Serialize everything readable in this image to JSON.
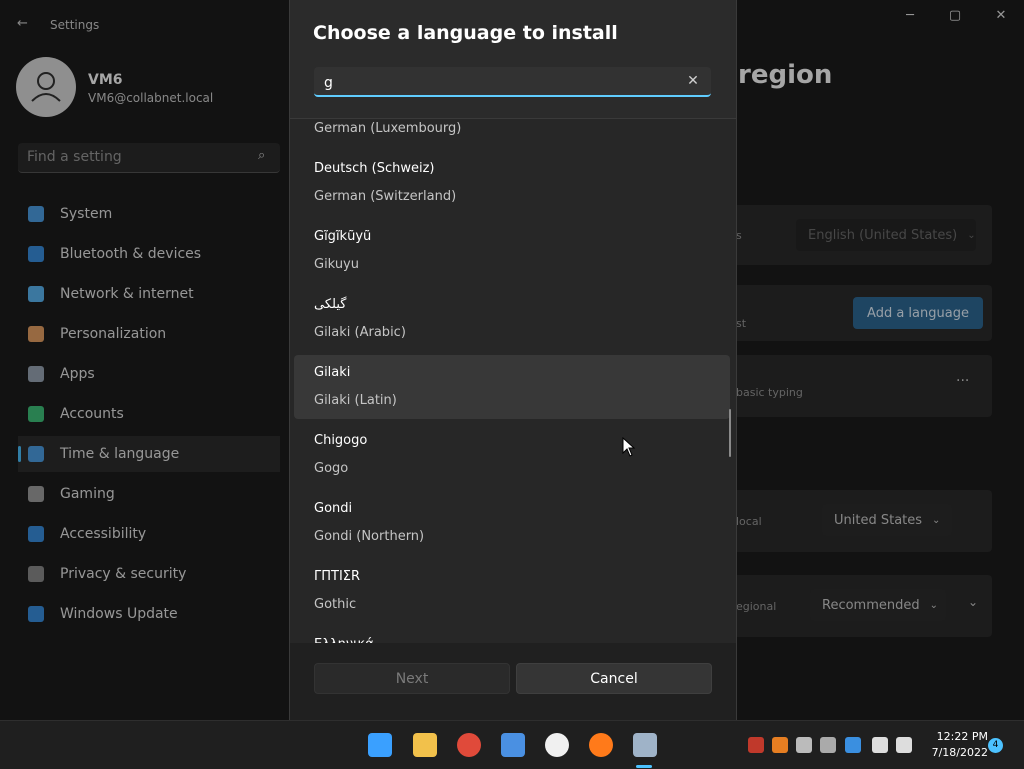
{
  "window": {
    "title": "Settings",
    "back_icon": "back-arrow-icon",
    "controls": {
      "minimize": "─",
      "maximize": "▢",
      "close": "✕"
    }
  },
  "user": {
    "name": "VM6",
    "email": "VM6@collabnet.local"
  },
  "search": {
    "placeholder": "Find a setting"
  },
  "sidebar": {
    "items": [
      {
        "label": "System",
        "icon": "system-icon",
        "color": "#4ea0e6"
      },
      {
        "label": "Bluetooth & devices",
        "icon": "bluetooth-icon",
        "color": "#3a8fe0"
      },
      {
        "label": "Network & internet",
        "icon": "network-icon",
        "color": "#5bb7f5"
      },
      {
        "label": "Personalization",
        "icon": "brush-icon",
        "color": "#e8a265"
      },
      {
        "label": "Apps",
        "icon": "apps-icon",
        "color": "#9aa7b5"
      },
      {
        "label": "Accounts",
        "icon": "accounts-icon",
        "color": "#3fc47c"
      },
      {
        "label": "Time & language",
        "icon": "globe-clock-icon",
        "color": "#4ea0e6"
      },
      {
        "label": "Gaming",
        "icon": "gaming-icon",
        "color": "#a0a0a0"
      },
      {
        "label": "Accessibility",
        "icon": "accessibility-icon",
        "color": "#3a8fe0"
      },
      {
        "label": "Privacy & security",
        "icon": "shield-icon",
        "color": "#8c8c8c"
      },
      {
        "label": "Windows Update",
        "icon": "update-icon",
        "color": "#3a8fe0"
      }
    ],
    "active_index": 6
  },
  "background_page": {
    "title_fragment": "region",
    "row1_fragment": "s",
    "display_language": "English (United States)",
    "row2_fragment": "st",
    "add_language_label": "Add a language",
    "basic_typing": "basic typing",
    "more_icon": "···",
    "local_fragment": "local",
    "country": "United States",
    "regional_fragment": "egional",
    "format": "Recommended"
  },
  "dialog": {
    "title": "Choose a language to install",
    "search_value": "g",
    "clear_icon": "✕",
    "languages": [
      {
        "native": "",
        "english": "German (Luxembourg)"
      },
      {
        "native": "Deutsch (Schweiz)",
        "english": "German (Switzerland)"
      },
      {
        "native": "Gĩgĩkũyũ",
        "english": "Gikuyu"
      },
      {
        "native": "گیلکی",
        "english": "Gilaki (Arabic)"
      },
      {
        "native": "Gilaki",
        "english": "Gilaki (Latin)"
      },
      {
        "native": "Chigogo",
        "english": "Gogo"
      },
      {
        "native": "Gondi",
        "english": "Gondi (Northern)"
      },
      {
        "native": "ΓΠΤΙΣR",
        "english": "Gothic"
      },
      {
        "native": "Ελληνικά",
        "english": ""
      }
    ],
    "highlighted_index": 4,
    "next_label": "Next",
    "cancel_label": "Cancel"
  },
  "taskbar": {
    "icons": [
      {
        "name": "start-icon",
        "color": "#3aa0ff"
      },
      {
        "name": "file-explorer-icon",
        "color": "#f2c14b"
      },
      {
        "name": "chrome-icon",
        "color": "#e04a3a"
      },
      {
        "name": "store-icon",
        "color": "#4a90e2"
      },
      {
        "name": "brave-icon",
        "color": "#f0f0f0"
      },
      {
        "name": "firefox-icon",
        "color": "#ff7a1a"
      },
      {
        "name": "settings-icon",
        "color": "#9fb3c8"
      }
    ],
    "tray": [
      {
        "name": "app-tray-icon",
        "color": "#c0392b"
      },
      {
        "name": "office-tray-icon",
        "color": "#e67e22"
      },
      {
        "name": "b-tray-icon",
        "color": "#bbbbbb"
      },
      {
        "name": "onedrive-offline-icon",
        "color": "#aaaaaa"
      },
      {
        "name": "defender-icon",
        "color": "#3a8fe0"
      },
      {
        "name": "network-tray-icon",
        "color": "#dddddd"
      },
      {
        "name": "volume-icon",
        "color": "#dddddd"
      }
    ],
    "time": "12:22 PM",
    "date": "7/18/2022",
    "notifications": "4"
  }
}
